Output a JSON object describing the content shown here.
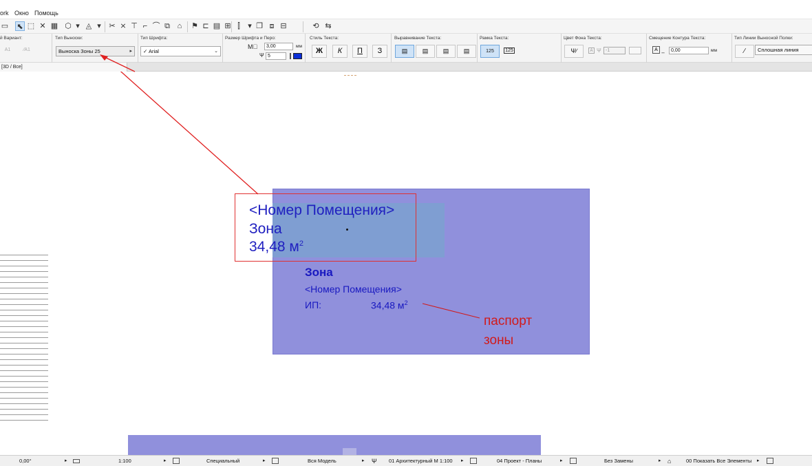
{
  "menu": {
    "items": [
      "ork",
      "Окно",
      "Помощь"
    ]
  },
  "info_box": {
    "variant_label": "й Вариант:",
    "callout_type": {
      "label": "Тип Выноски:",
      "value": "Выноска Зоны 25"
    },
    "font_type": {
      "label": "Тип Шрифта:",
      "value": "Arial"
    },
    "font_size_pen": {
      "label": "Размер Шрифта и Перо:",
      "size_value": "3,00",
      "size_unit": "мм",
      "pen_value": "5"
    },
    "text_style": {
      "label": "Стиль Текста:",
      "bold": "Ж",
      "italic": "К",
      "underline": "П",
      "strike": "З"
    },
    "alignment": {
      "label": "Выравнивание Текста:"
    },
    "text_frame": {
      "label": "Рамка Текста:",
      "option1": "125",
      "option2": "125"
    },
    "bg_color": {
      "label": "Цвет Фона Текста:",
      "pen_value": "-1"
    },
    "contour_offset": {
      "label": "Смещение Контура Текста:",
      "value": "0,00",
      "unit": "мм"
    },
    "leader_line": {
      "label": "Тип Линии Выносной Полки:",
      "value": "Сплошная линия"
    }
  },
  "view_tab": {
    "label": "[3D / Все]"
  },
  "canvas": {
    "label_callout": {
      "line1": "<Номер Помещения>",
      "line2": "Зона",
      "area": "34,48 м",
      "sup": "2"
    },
    "zone_stamp": {
      "title": "Зона",
      "room_number": "<Номер Помещения>",
      "area_label": "ИП:",
      "area_value": "34,48 м",
      "sup": "2"
    },
    "annotation": {
      "line1": "паспорт",
      "line2": "зоны"
    }
  },
  "status_bar": {
    "angle": "0,00°",
    "scale": "1:100",
    "structure": "Специальный",
    "model": "Вся Модель",
    "pen_set": "01 Архитектурный М 1:100",
    "model_view": "04 Проект - Планы",
    "override": "Без Замены",
    "renovation": "00 Показать Все Элементы"
  },
  "colors": {
    "zone_fill": "#9090dc",
    "zone_inner": "#7f9ed2",
    "label_text": "#2020c0",
    "annotation": "#d11a1a"
  }
}
